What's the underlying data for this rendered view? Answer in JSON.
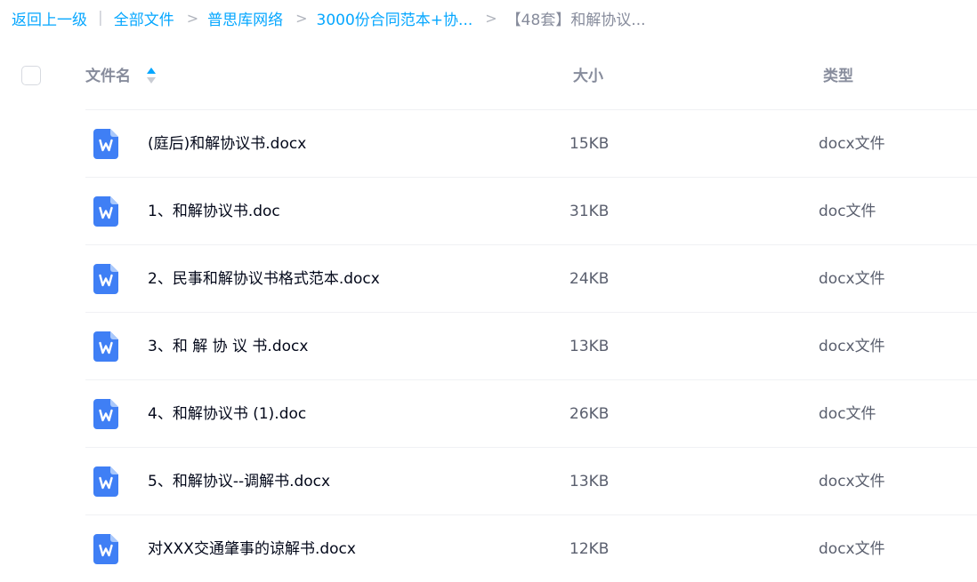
{
  "breadcrumb": {
    "back_label": "返回上一级",
    "divider": "|",
    "separator": ">",
    "items": [
      "全部文件",
      "普思库网络",
      "3000份合同范本+协...",
      "【48套】和解协议..."
    ]
  },
  "header": {
    "name_label": "文件名",
    "size_label": "大小",
    "type_label": "类型",
    "sort_icon": "sort-ascending-icon"
  },
  "colors": {
    "link": "#06a7ff",
    "doc_icon": "#3f7ff5",
    "muted": "#878c9c"
  },
  "files": [
    {
      "name": "(庭后)和解协议书.docx",
      "size": "15KB",
      "type": "docx文件",
      "icon": "word-doc-icon"
    },
    {
      "name": "1、和解协议书.doc",
      "size": "31KB",
      "type": "doc文件",
      "icon": "word-doc-icon"
    },
    {
      "name": "2、民事和解协议书格式范本.docx",
      "size": "24KB",
      "type": "docx文件",
      "icon": "word-doc-icon"
    },
    {
      "name": "3、和 解 协 议 书.docx",
      "size": "13KB",
      "type": "docx文件",
      "icon": "word-doc-icon"
    },
    {
      "name": "4、和解协议书 (1).doc",
      "size": "26KB",
      "type": "doc文件",
      "icon": "word-doc-icon"
    },
    {
      "name": "5、和解协议--调解书.docx",
      "size": "13KB",
      "type": "docx文件",
      "icon": "word-doc-icon"
    },
    {
      "name": "对XXX交通肇事的谅解书.docx",
      "size": "12KB",
      "type": "docx文件",
      "icon": "word-doc-icon"
    }
  ]
}
